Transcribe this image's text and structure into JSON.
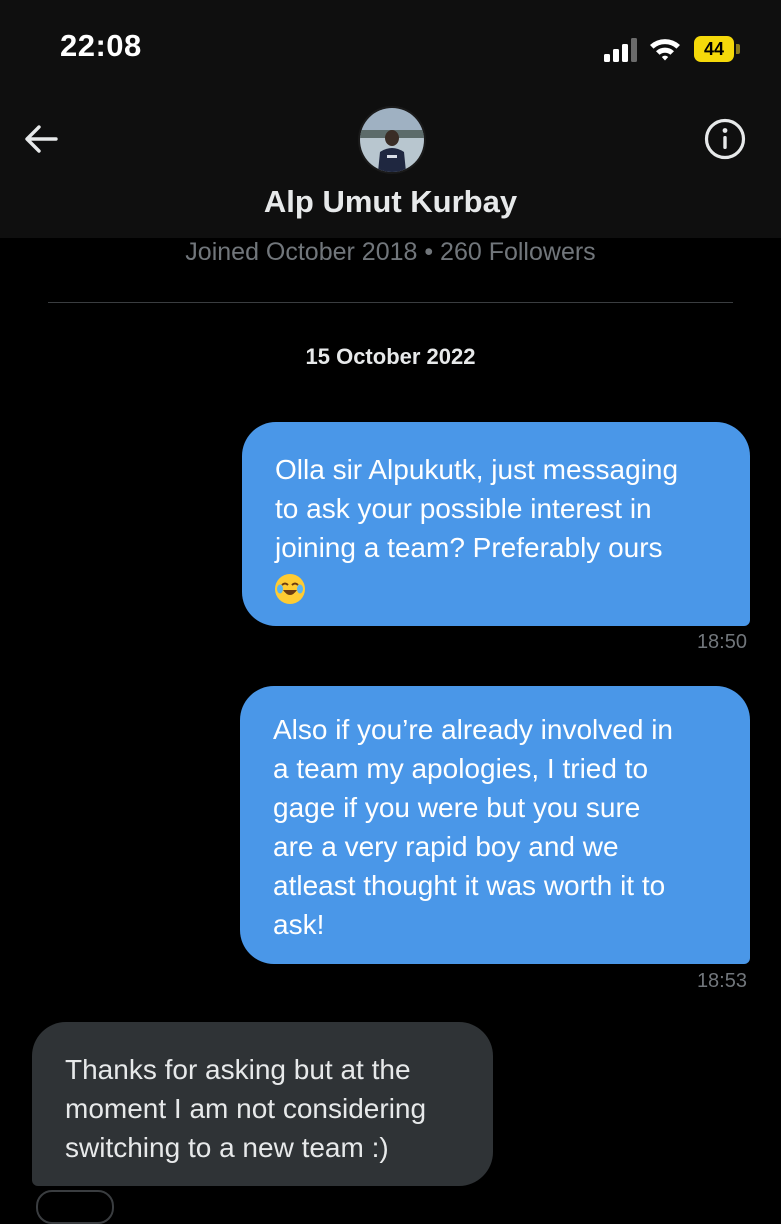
{
  "status_bar": {
    "time": "22:08",
    "battery": "44",
    "icons": [
      "signal-icon",
      "wifi-icon",
      "battery-icon"
    ]
  },
  "header": {
    "display_name": "Alp Umut Kurbay",
    "back_icon": "arrow-left-icon",
    "info_icon": "info-circle-icon"
  },
  "profile": {
    "meta": "Joined October 2018 • 260 Followers"
  },
  "conversation": {
    "date_separator": "15 October 2022",
    "messages": [
      {
        "direction": "sent",
        "text": "Olla sir Alpukutk, just messaging\nto ask your possible interest in\njoining a team? Preferably ours",
        "emoji": "face-with-tears-of-joy",
        "time": "18:50"
      },
      {
        "direction": "sent",
        "text": "Also if you’re already involved in\na team my apologies, I tried to\ngage if you were but you sure\nare a very rapid boy and we\natleast thought it was worth it to\nask!",
        "time": "18:53"
      },
      {
        "direction": "received",
        "text": "Thanks for asking but at the\nmoment I am not considering\nswitching to a new team :)"
      }
    ]
  },
  "colors": {
    "background": "#000000",
    "sent_bubble": "#4a97e8",
    "received_bubble": "#2f3336",
    "secondary_text": "#71767b",
    "battery": "#f5d90a"
  }
}
